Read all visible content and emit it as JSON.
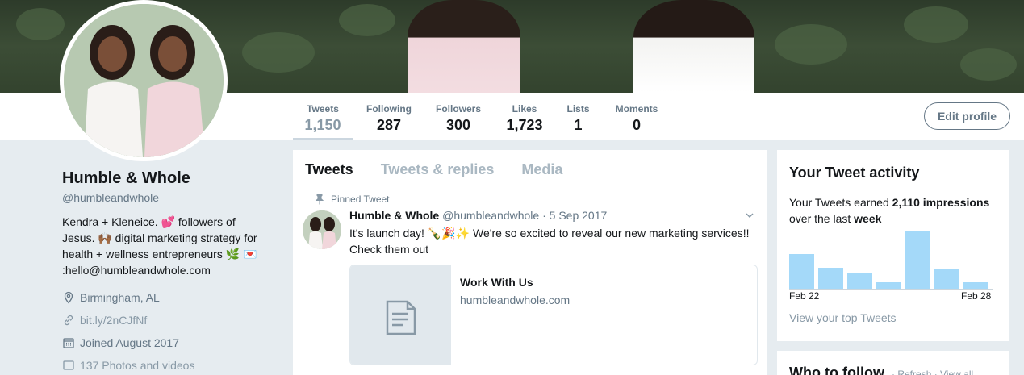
{
  "stats": [
    {
      "label": "Tweets",
      "value": "1,150",
      "active": true
    },
    {
      "label": "Following",
      "value": "287"
    },
    {
      "label": "Followers",
      "value": "300"
    },
    {
      "label": "Likes",
      "value": "1,723"
    },
    {
      "label": "Lists",
      "value": "1"
    },
    {
      "label": "Moments",
      "value": "0"
    }
  ],
  "edit_profile_label": "Edit profile",
  "profile": {
    "name": "Humble & Whole",
    "handle": "@humbleandwhole",
    "bio_line1": "Kendra + Kleneice. 💕 followers of",
    "bio_line2": "Jesus. 🙌🏾 digital marketing strategy for",
    "bio_line3": "health + wellness entrepreneurs 🌿 💌",
    "bio_line4": ":hello@humbleandwhole.com",
    "location": "Birmingham, AL",
    "website": "bit.ly/2nCJfNf",
    "joined": "Joined August 2017",
    "photos": "137 Photos and videos"
  },
  "timeline": {
    "tabs": [
      "Tweets",
      "Tweets & replies",
      "Media"
    ],
    "pinned_label": "Pinned Tweet",
    "tweet": {
      "name": "Humble & Whole",
      "handle": "@humbleandwhole",
      "sep": " · ",
      "date": "5 Sep 2017",
      "text_line1": "It's launch day! 🍾🎉✨ We're so excited to reveal our new marketing services!!",
      "text_line2": "Check them out",
      "card": {
        "title": "Work With Us",
        "url": "humbleandwhole.com"
      }
    }
  },
  "activity": {
    "title": "Your Tweet activity",
    "text_pre": "Your Tweets earned ",
    "impressions": "2,110 impressions",
    "text_mid": "over the last ",
    "period": "week",
    "date_start": "Feb 22",
    "date_end": "Feb 28",
    "bar_values": [
      0.56,
      0.35,
      0.27,
      0.11,
      0.92,
      0.33,
      0.11
    ],
    "link": "View your top Tweets"
  },
  "who_to_follow": {
    "title": "Who to follow",
    "refresh": "Refresh",
    "view_all": "View all",
    "sep": " · "
  },
  "colors": {
    "accent": "#1da1f2",
    "bar": "#a4d9f9",
    "muted": "#657786"
  }
}
